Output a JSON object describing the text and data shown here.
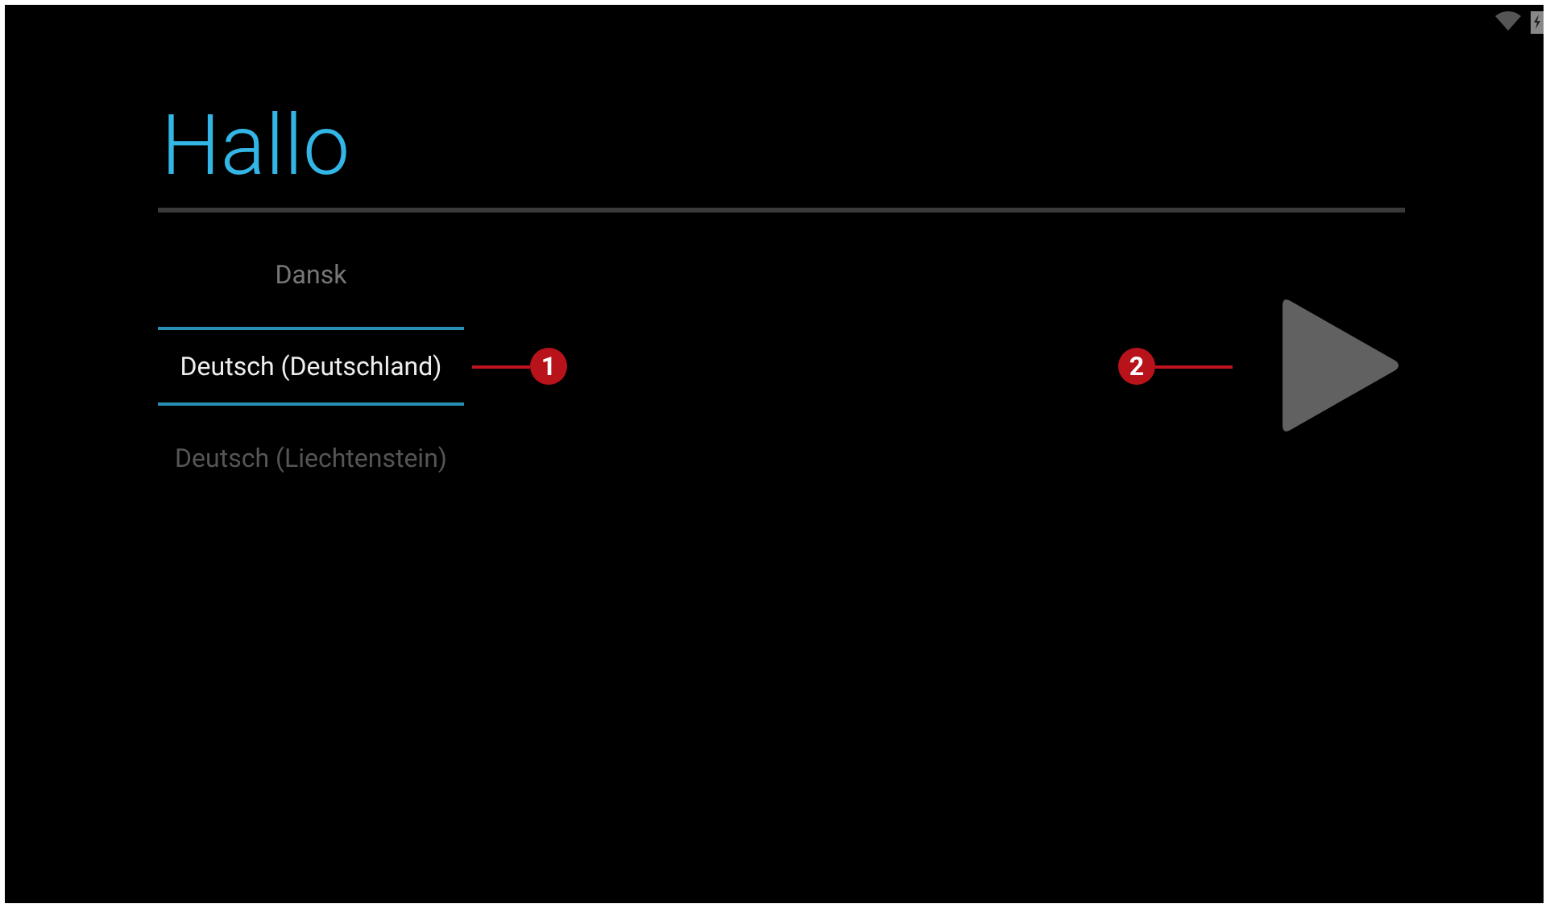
{
  "title": "Hallo",
  "languages": [
    {
      "label": "Dansk",
      "selected": false
    },
    {
      "label": "Deutsch (Deutschland)",
      "selected": true
    },
    {
      "label": "Deutsch (Liechtenstein)",
      "selected": false
    }
  ],
  "callouts": [
    {
      "number": "1",
      "kind": "left"
    },
    {
      "number": "2",
      "kind": "right"
    }
  ]
}
